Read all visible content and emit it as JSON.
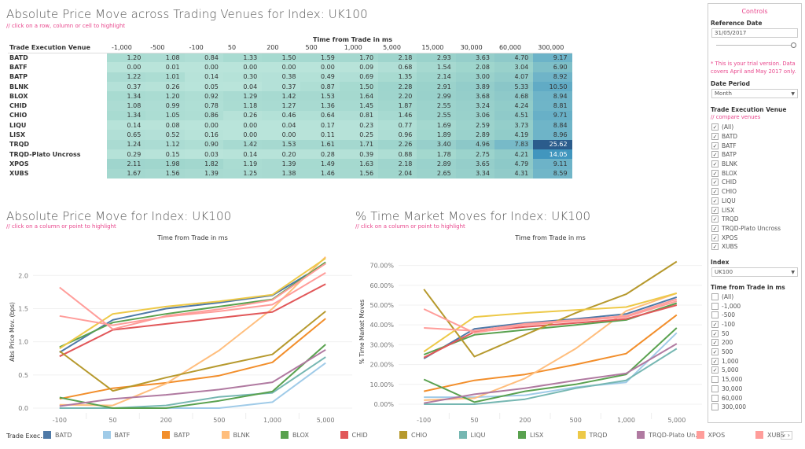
{
  "heatmap": {
    "title": "Absolute Price Move across Trading Venues for Index: UK100",
    "hint": "// click on a row, column or cell to highlight",
    "column_axis_title": "Time from Trade in ms",
    "row_header": "Trade Execution Venue",
    "columns": [
      "-1,000",
      "-500",
      "-100",
      "50",
      "200",
      "500",
      "1,000",
      "5,000",
      "15,000",
      "30,000",
      "60,000",
      "300,000"
    ],
    "rows": [
      {
        "venue": "BATD",
        "values": [
          "1.20",
          "1.08",
          "0.84",
          "1.33",
          "1.50",
          "1.59",
          "1.70",
          "2.18",
          "2.93",
          "3.63",
          "4.70",
          "9.17"
        ]
      },
      {
        "venue": "BATF",
        "values": [
          "0.00",
          "0.01",
          "0.00",
          "0.00",
          "0.00",
          "0.00",
          "0.09",
          "0.68",
          "1.54",
          "2.08",
          "3.04",
          "6.90"
        ]
      },
      {
        "venue": "BATP",
        "values": [
          "1.22",
          "1.01",
          "0.14",
          "0.30",
          "0.38",
          "0.49",
          "0.69",
          "1.35",
          "2.14",
          "3.00",
          "4.07",
          "8.92"
        ]
      },
      {
        "venue": "BLNK",
        "values": [
          "0.37",
          "0.26",
          "0.05",
          "0.04",
          "0.37",
          "0.87",
          "1.50",
          "2.28",
          "2.91",
          "3.89",
          "5.33",
          "10.50"
        ]
      },
      {
        "venue": "BLOX",
        "values": [
          "1.34",
          "1.20",
          "0.92",
          "1.29",
          "1.42",
          "1.53",
          "1.64",
          "2.20",
          "2.99",
          "3.68",
          "4.68",
          "8.94"
        ]
      },
      {
        "venue": "CHID",
        "values": [
          "1.08",
          "0.99",
          "0.78",
          "1.18",
          "1.27",
          "1.36",
          "1.45",
          "1.87",
          "2.55",
          "3.24",
          "4.24",
          "8.81"
        ]
      },
      {
        "venue": "CHIO",
        "values": [
          "1.34",
          "1.05",
          "0.86",
          "0.26",
          "0.46",
          "0.64",
          "0.81",
          "1.46",
          "2.55",
          "3.06",
          "4.51",
          "9.71"
        ]
      },
      {
        "venue": "LIQU",
        "values": [
          "0.14",
          "0.08",
          "0.00",
          "0.00",
          "0.04",
          "0.17",
          "0.23",
          "0.77",
          "1.69",
          "2.59",
          "3.73",
          "8.84"
        ]
      },
      {
        "venue": "LISX",
        "values": [
          "0.65",
          "0.52",
          "0.16",
          "0.00",
          "0.00",
          "0.11",
          "0.25",
          "0.96",
          "1.89",
          "2.89",
          "4.19",
          "8.96"
        ]
      },
      {
        "venue": "TRQD",
        "values": [
          "1.24",
          "1.12",
          "0.90",
          "1.42",
          "1.53",
          "1.61",
          "1.71",
          "2.26",
          "3.40",
          "4.96",
          "7.83",
          "25.62"
        ]
      },
      {
        "venue": "TRQD-Plato Uncross",
        "values": [
          "0.29",
          "0.15",
          "0.03",
          "0.14",
          "0.20",
          "0.28",
          "0.39",
          "0.88",
          "1.78",
          "2.75",
          "4.21",
          "14.05"
        ]
      },
      {
        "venue": "XPOS",
        "values": [
          "2.11",
          "1.98",
          "1.82",
          "1.19",
          "1.39",
          "1.49",
          "1.63",
          "2.18",
          "2.89",
          "3.65",
          "4.79",
          "9.11"
        ]
      },
      {
        "venue": "XUBS",
        "values": [
          "1.67",
          "1.56",
          "1.39",
          "1.25",
          "1.38",
          "1.46",
          "1.56",
          "2.04",
          "2.65",
          "3.34",
          "4.31",
          "8.59"
        ]
      }
    ],
    "color_scale": {
      "low": "#b9e4da",
      "high": "#2a5a8a"
    }
  },
  "left_chart_header": {
    "title": "Absolute Price Move for Index: UK100",
    "hint": "// click on a column or point to highlight"
  },
  "right_chart_header": {
    "title": "% Time Market Moves for Index: UK100",
    "hint": "// click on a column or point to highlight"
  },
  "chart_data": [
    {
      "type": "line",
      "title": "Absolute Price Move for Index: UK100",
      "xlabel": "Time from Trade in ms",
      "ylabel": "Abs Price Mov. (bps)",
      "categories": [
        "-100",
        "50",
        "200",
        "500",
        "1,000",
        "5,000"
      ],
      "ylim": [
        0,
        2.3
      ],
      "yticks": [
        0.0,
        0.5,
        1.0,
        1.5,
        2.0
      ],
      "ytick_labels": [
        "0.0",
        "0.5",
        "1.0",
        "1.5",
        "2.0"
      ],
      "grid": true,
      "series": [
        {
          "name": "BATD",
          "color": "#4e79a7",
          "values": [
            0.84,
            1.33,
            1.5,
            1.59,
            1.7,
            2.18
          ]
        },
        {
          "name": "BATF",
          "color": "#a0cbe8",
          "values": [
            0.0,
            0.0,
            0.0,
            0.0,
            0.09,
            0.68
          ]
        },
        {
          "name": "BATP",
          "color": "#f28e2b",
          "values": [
            0.14,
            0.3,
            0.38,
            0.49,
            0.69,
            1.35
          ]
        },
        {
          "name": "BLNK",
          "color": "#ffbe7d",
          "values": [
            0.05,
            0.04,
            0.37,
            0.87,
            1.5,
            2.28
          ]
        },
        {
          "name": "BLOX",
          "color": "#59a14f",
          "values": [
            0.92,
            1.29,
            1.42,
            1.53,
            1.64,
            2.2
          ]
        },
        {
          "name": "CHID",
          "color": "#e15759",
          "values": [
            0.78,
            1.18,
            1.27,
            1.36,
            1.45,
            1.87
          ]
        },
        {
          "name": "CHIO",
          "color": "#b6992d",
          "values": [
            0.86,
            0.26,
            0.46,
            0.64,
            0.81,
            1.46
          ]
        },
        {
          "name": "LIQU",
          "color": "#76b7b2",
          "values": [
            0.0,
            0.0,
            0.04,
            0.17,
            0.23,
            0.77
          ]
        },
        {
          "name": "LISX",
          "color": "#59a14f",
          "values": [
            0.16,
            0.0,
            0.0,
            0.11,
            0.25,
            0.96
          ]
        },
        {
          "name": "TRQD",
          "color": "#edc948",
          "values": [
            0.9,
            1.42,
            1.53,
            1.61,
            1.71,
            2.26
          ]
        },
        {
          "name": "TRQD-Plato Uncross",
          "color": "#b07aa1",
          "values": [
            0.03,
            0.14,
            0.2,
            0.28,
            0.39,
            0.88
          ]
        },
        {
          "name": "XPOS",
          "color": "#ff9d9a",
          "values": [
            1.82,
            1.19,
            1.39,
            1.49,
            1.63,
            2.18
          ]
        },
        {
          "name": "XUBS",
          "color": "#ff9d9a",
          "values": [
            1.39,
            1.25,
            1.38,
            1.46,
            1.56,
            2.04
          ]
        }
      ]
    },
    {
      "type": "line",
      "title": "% Time Market Moves for Index: UK100",
      "xlabel": "Time from Trade in ms",
      "ylabel": "% Time Market Moves",
      "categories": [
        "-100",
        "50",
        "200",
        "500",
        "1,000",
        "5,000"
      ],
      "ylim": [
        -2,
        75
      ],
      "yticks": [
        0,
        10,
        20,
        30,
        40,
        50,
        60,
        70
      ],
      "ytick_labels": [
        "0.00%",
        "10.00%",
        "20.00%",
        "30.00%",
        "40.00%",
        "50.00%",
        "60.00%",
        "70.00%"
      ],
      "grid": true,
      "series": [
        {
          "name": "BATD",
          "color": "#4e79a7",
          "values": [
            23,
            38,
            41,
            43,
            45.5,
            54
          ]
        },
        {
          "name": "BATF",
          "color": "#a0cbe8",
          "values": [
            3.5,
            3.5,
            4.5,
            8.5,
            11,
            36
          ]
        },
        {
          "name": "BATP",
          "color": "#f28e2b",
          "values": [
            6.5,
            12,
            15,
            20,
            25.5,
            45
          ]
        },
        {
          "name": "BLNK",
          "color": "#ffbe7d",
          "values": [
            2,
            3,
            13,
            28,
            47,
            56
          ]
        },
        {
          "name": "BLOX",
          "color": "#59a14f",
          "values": [
            25,
            35,
            37.5,
            40,
            42.5,
            51
          ]
        },
        {
          "name": "CHID",
          "color": "#e15759",
          "values": [
            23.5,
            36.5,
            39,
            41,
            43,
            50
          ]
        },
        {
          "name": "CHIO",
          "color": "#b6992d",
          "values": [
            58,
            24,
            35,
            46,
            55.5,
            72
          ]
        },
        {
          "name": "LIQU",
          "color": "#76b7b2",
          "values": [
            0,
            0,
            2.5,
            8,
            12,
            28
          ]
        },
        {
          "name": "LISX",
          "color": "#59a14f",
          "values": [
            12.5,
            1,
            6.5,
            10,
            15,
            38.5
          ]
        },
        {
          "name": "TRQD",
          "color": "#edc948",
          "values": [
            26.5,
            44,
            46,
            47.5,
            49,
            56
          ]
        },
        {
          "name": "TRQD-Plato Uncross",
          "color": "#b07aa1",
          "values": [
            0.5,
            5,
            8,
            12,
            15.5,
            30.5
          ]
        },
        {
          "name": "XPOS",
          "color": "#ff9d9a",
          "values": [
            48,
            36,
            40,
            42,
            44,
            52
          ]
        },
        {
          "name": "XUBS",
          "color": "#ff9d9a",
          "values": [
            38.5,
            37,
            40.5,
            42.5,
            44.5,
            53
          ]
        }
      ]
    }
  ],
  "legend": {
    "title": "Trade Exec...",
    "items": [
      {
        "label": "BATD",
        "color": "#4e79a7"
      },
      {
        "label": "BATF",
        "color": "#a0cbe8"
      },
      {
        "label": "BATP",
        "color": "#f28e2b"
      },
      {
        "label": "BLNK",
        "color": "#ffbe7d"
      },
      {
        "label": "BLOX",
        "color": "#59a14f"
      },
      {
        "label": "CHID",
        "color": "#e15759"
      },
      {
        "label": "CHIO",
        "color": "#b6992d"
      },
      {
        "label": "LIQU",
        "color": "#76b7b2"
      },
      {
        "label": "LISX",
        "color": "#59a14f"
      },
      {
        "label": "TRQD",
        "color": "#edc948"
      },
      {
        "label": "TRQD-Plato Un...",
        "color": "#b07aa1"
      },
      {
        "label": "XPOS",
        "color": "#ff9d9a"
      },
      {
        "label": "XUBS",
        "color": "#ff9d9a"
      }
    ],
    "nav_label": "‹ ›"
  },
  "controls": {
    "title": "Controls",
    "reference_date_label": "Reference Date",
    "reference_date_value": "31/05/2017",
    "trial_note": "* This is your trial version. Data covers April and May 2017 only.",
    "date_period_label": "Date Period",
    "date_period_value": "Month",
    "venue_label": "Trade Execution Venue",
    "venue_hint": "// compare venues",
    "venues": [
      {
        "label": "(All)",
        "checked": true
      },
      {
        "label": "BATD",
        "checked": true
      },
      {
        "label": "BATF",
        "checked": true
      },
      {
        "label": "BATP",
        "checked": true
      },
      {
        "label": "BLNK",
        "checked": true
      },
      {
        "label": "BLOX",
        "checked": true
      },
      {
        "label": "CHID",
        "checked": true
      },
      {
        "label": "CHIO",
        "checked": true
      },
      {
        "label": "LIQU",
        "checked": true
      },
      {
        "label": "LISX",
        "checked": true
      },
      {
        "label": "TRQD",
        "checked": true
      },
      {
        "label": "TRQD-Plato Uncross",
        "checked": true
      },
      {
        "label": "XPOS",
        "checked": true
      },
      {
        "label": "XUBS",
        "checked": true
      }
    ],
    "index_label": "Index",
    "index_value": "UK100",
    "time_label": "Time from Trade in ms",
    "times": [
      {
        "label": "(All)",
        "checked": false
      },
      {
        "label": "-1,000",
        "checked": false
      },
      {
        "label": "-500",
        "checked": false
      },
      {
        "label": "-100",
        "checked": true
      },
      {
        "label": "50",
        "checked": true
      },
      {
        "label": "200",
        "checked": true
      },
      {
        "label": "500",
        "checked": true
      },
      {
        "label": "1,000",
        "checked": true
      },
      {
        "label": "5,000",
        "checked": true
      },
      {
        "label": "15,000",
        "checked": false
      },
      {
        "label": "30,000",
        "checked": false
      },
      {
        "label": "60,000",
        "checked": false
      },
      {
        "label": "300,000",
        "checked": false
      }
    ]
  }
}
